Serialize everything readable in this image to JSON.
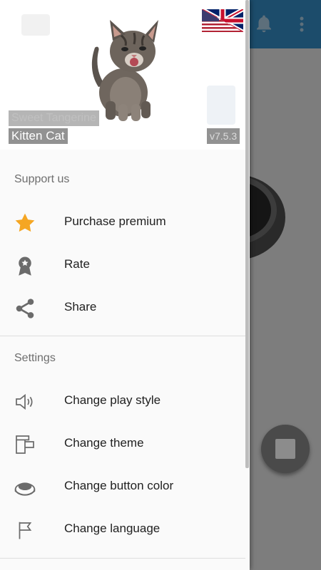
{
  "header": {
    "subtitle": "Sweet Tangerine",
    "title": "Kitten Cat",
    "version": "v7.5.3"
  },
  "support_section": {
    "title": "Support us",
    "items": [
      {
        "label": "Purchase premium",
        "icon": "star-icon"
      },
      {
        "label": "Rate",
        "icon": "award-icon"
      },
      {
        "label": "Share",
        "icon": "share-icon"
      }
    ]
  },
  "settings_section": {
    "title": "Settings",
    "items": [
      {
        "label": "Change play style",
        "icon": "speaker-icon"
      },
      {
        "label": "Change theme",
        "icon": "theme-icon"
      },
      {
        "label": "Change button color",
        "icon": "button-color-icon"
      },
      {
        "label": "Change language",
        "icon": "flag-icon"
      }
    ]
  },
  "colors": {
    "toolbar": "#1c4c6b",
    "star": "#f5a623",
    "icon_gray": "#6b6b6b"
  }
}
